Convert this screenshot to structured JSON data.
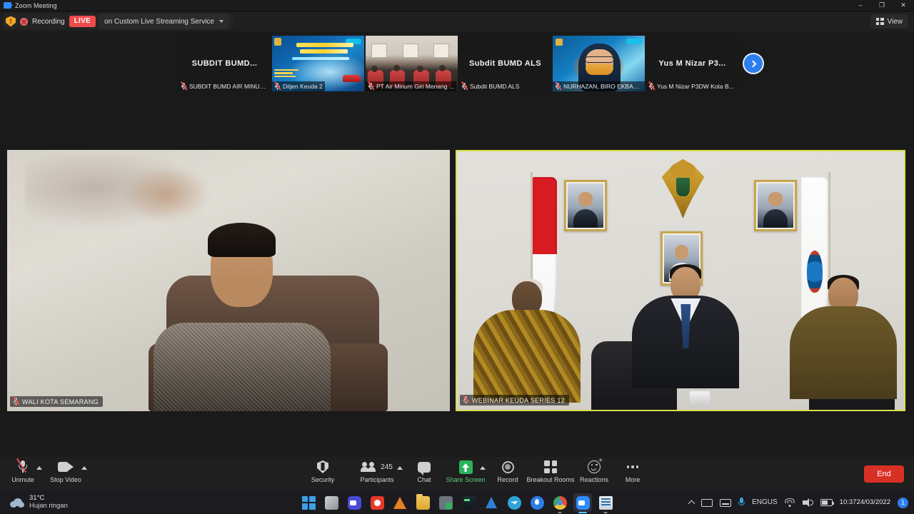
{
  "window": {
    "title": "Zoom Meeting",
    "app_icon": "zoom-icon",
    "controls": {
      "minimize": "–",
      "maximize": "❐",
      "close": "✕"
    }
  },
  "topbar": {
    "security_icon": "shield-warning-icon",
    "recording_label": "Recording",
    "live_badge": "LIVE",
    "live_service": "on Custom Live Streaming Service",
    "dropdown_icon": "chevron-down-icon",
    "view_button": {
      "label": "View",
      "icon": "grid-view-icon"
    }
  },
  "filmstrip": {
    "next_icon": "chevron-right-icon",
    "thumbnails": [
      {
        "center_name": "SUBDIT BUMD...",
        "name": "SUBDIT BUMD AIR MINUM...",
        "muted": true,
        "kind": "name-only"
      },
      {
        "center_name": "",
        "name": "Ditjen Keuda 2",
        "muted": true,
        "kind": "slide"
      },
      {
        "center_name": "",
        "name": "PT Air Minum Giri Menang ...",
        "muted": true,
        "kind": "room"
      },
      {
        "center_name": "Subdit BUMD ALS",
        "name": "Subdit BUMD ALS",
        "muted": true,
        "kind": "name-only"
      },
      {
        "center_name": "",
        "name": "NURHAZAN, BIRO EKBANG...",
        "muted": true,
        "kind": "person"
      },
      {
        "center_name": "Yus M Nizar P3...",
        "name": "Yus M Nizar P3DW Kota B...",
        "muted": true,
        "kind": "name-only"
      }
    ]
  },
  "stage": {
    "left_tile": {
      "name": "WALI KOTA SEMARANG",
      "muted": true,
      "speaking": false
    },
    "right_tile": {
      "name": "WEBINAR KEUDA SERIES 12",
      "muted": true,
      "speaking": true,
      "highlight_color": "#d7e14b"
    }
  },
  "controls": [
    {
      "name": "unmute",
      "label": "Unmute",
      "icon": "microphone-muted-icon",
      "has_caret": true,
      "accent": "#e05252"
    },
    {
      "name": "stop-video",
      "label": "Stop Video",
      "icon": "camera-icon",
      "has_caret": true
    },
    {
      "name": "security",
      "label": "Security",
      "icon": "shield-icon",
      "has_caret": false
    },
    {
      "name": "participants",
      "label": "Participants",
      "icon": "people-icon",
      "count": "245",
      "has_caret": true
    },
    {
      "name": "chat",
      "label": "Chat",
      "icon": "chat-bubble-icon",
      "has_caret": false
    },
    {
      "name": "share-screen",
      "label": "Share Screen",
      "icon": "share-screen-icon",
      "has_caret": true,
      "accent": "#2bb35a"
    },
    {
      "name": "record",
      "label": "Record",
      "icon": "record-circle-icon",
      "has_caret": false
    },
    {
      "name": "breakout-rooms",
      "label": "Breakout Rooms",
      "icon": "grid-squares-icon",
      "has_caret": false
    },
    {
      "name": "reactions",
      "label": "Reactions",
      "icon": "smiley-plus-icon",
      "has_caret": false
    },
    {
      "name": "more",
      "label": "More",
      "icon": "ellipsis-icon",
      "has_caret": false
    }
  ],
  "end_button": {
    "label": "End",
    "color": "#d93025"
  },
  "taskbar": {
    "weather": {
      "temperature": "31°C",
      "condition": "Hujan ringan",
      "icon": "cloud-rain-icon"
    },
    "apps": [
      {
        "name": "start",
        "icon": "windows-start-icon",
        "state": "idle"
      },
      {
        "name": "task-view",
        "icon": "task-view-icon",
        "state": "idle"
      },
      {
        "name": "zoom-workplace",
        "icon": "zoom-video-icon",
        "state": "idle"
      },
      {
        "name": "screen-recorder",
        "icon": "record-red-icon",
        "state": "idle"
      },
      {
        "name": "vlc",
        "icon": "vlc-cone-icon",
        "state": "idle"
      },
      {
        "name": "file-explorer",
        "icon": "folder-icon",
        "state": "idle"
      },
      {
        "name": "secure-app",
        "icon": "lock-shield-icon",
        "state": "idle"
      },
      {
        "name": "terminal",
        "icon": "terminal-icon",
        "state": "idle"
      },
      {
        "name": "vs-code",
        "icon": "vscode-icon",
        "state": "idle"
      },
      {
        "name": "telegram",
        "icon": "telegram-icon",
        "state": "idle"
      },
      {
        "name": "maps",
        "icon": "map-pin-icon",
        "state": "idle"
      },
      {
        "name": "chrome",
        "icon": "chrome-icon",
        "state": "open"
      },
      {
        "name": "zoom",
        "icon": "zoom-app-icon",
        "state": "active"
      },
      {
        "name": "notes",
        "icon": "notepad-icon",
        "state": "open"
      }
    ],
    "tray": {
      "chevron_icon": "chevron-up-icon",
      "keyboard_icon": "keyboard-icon",
      "ime_icon": "ime-icon",
      "mic_icon": "microphone-icon",
      "language": {
        "line1": "ENG",
        "line2": "US"
      },
      "wifi_icon": "wifi-icon",
      "volume_icon": "speaker-icon",
      "battery_icon": "battery-charging-icon",
      "time": "10:37",
      "date": "24/03/2022",
      "notification_count": "1"
    }
  }
}
